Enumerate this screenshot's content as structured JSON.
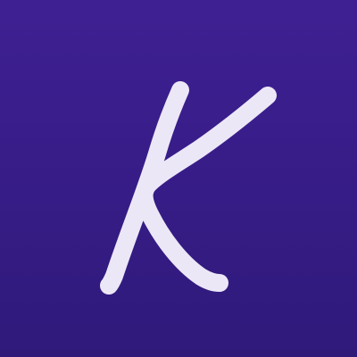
{
  "app_icon": {
    "glyph": "K",
    "icon_name": "letter-k-logo-icon",
    "colors": {
      "background_top": "#3f2093",
      "background_bottom": "#2f1a7a",
      "glyph": "#ece7f6"
    }
  }
}
